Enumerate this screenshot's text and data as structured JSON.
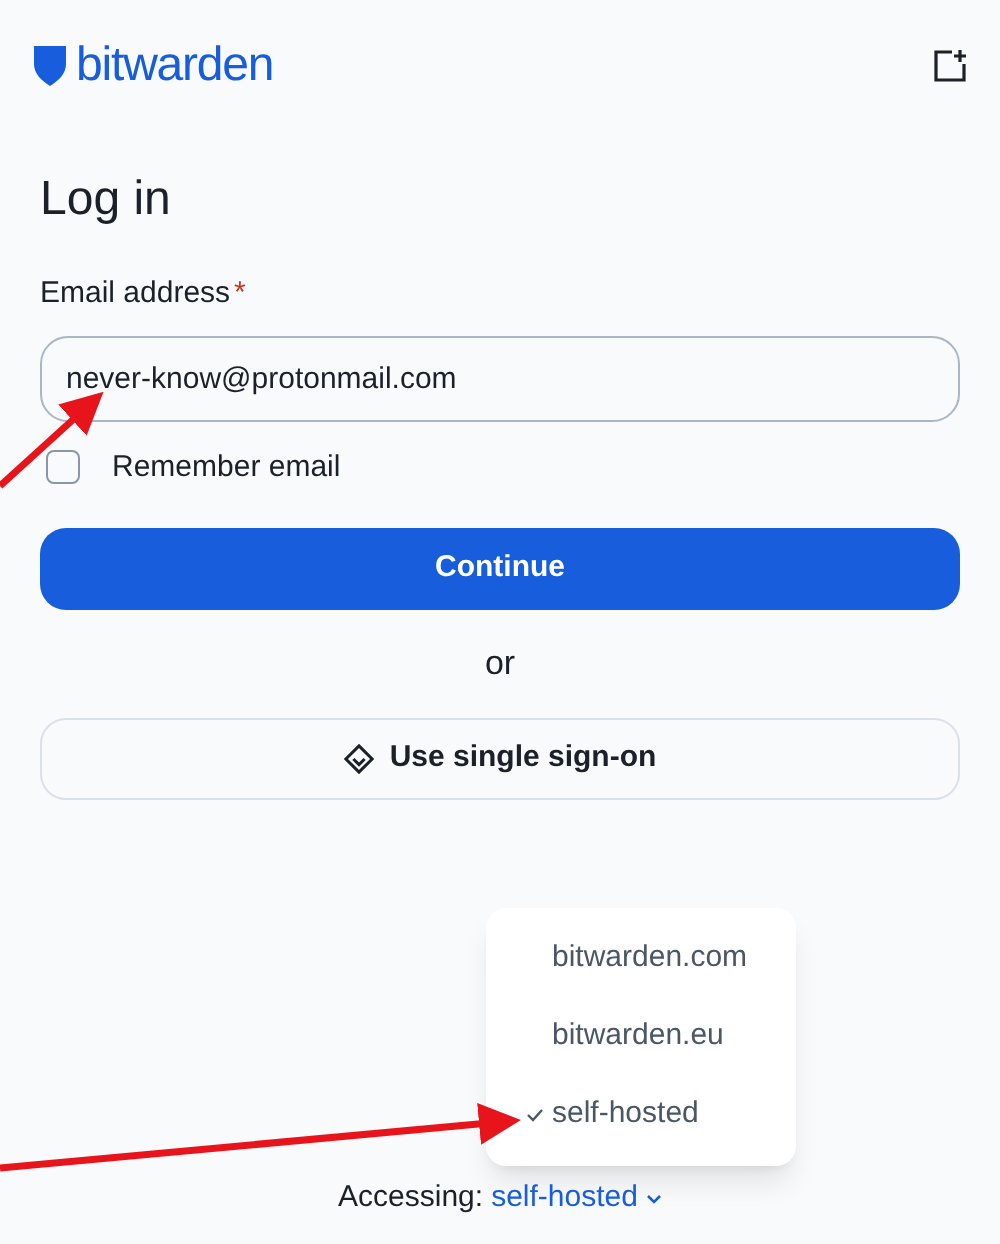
{
  "header": {
    "logo": "**bit**warden"
  },
  "title": "Log in",
  "email": {
    "label": "Email address",
    "required_mark": "*",
    "value": "never-know@protonmail.com"
  },
  "remember": {
    "label": "Remember email",
    "checked": false
  },
  "continue_button": "Continue",
  "separator": "or",
  "sso_button": "Use single sign-on",
  "region_menu": [
    {
      "label": "bitwarden.com",
      "selected": false
    },
    {
      "label": "bitwarden.eu",
      "selected": false
    },
    {
      "label": "self-hosted",
      "selected": true
    }
  ],
  "footer": {
    "label": "Accessing:",
    "value": "self-hosted"
  }
}
